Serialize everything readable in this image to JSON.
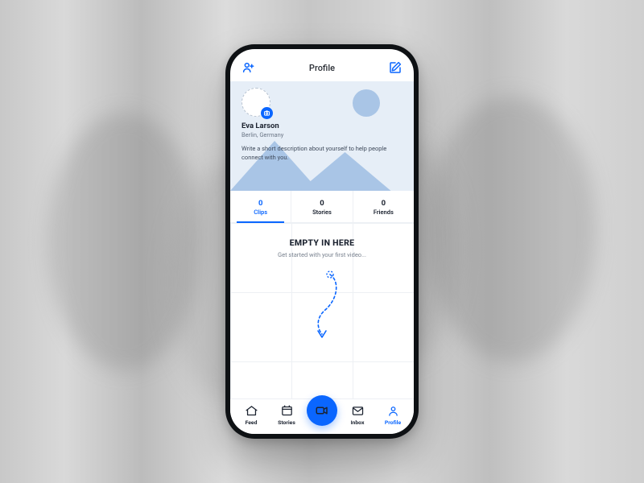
{
  "header": {
    "title": "Profile"
  },
  "profile": {
    "name": "Eva Larson",
    "location": "Berlin, Germany",
    "bio": "Write a short description about yourself to help people connect with you."
  },
  "stats": {
    "clips": {
      "count": "0",
      "label": "Clips"
    },
    "stories": {
      "count": "0",
      "label": "Stories"
    },
    "friends": {
      "count": "0",
      "label": "Friends"
    }
  },
  "empty": {
    "title": "EMPTY IN HERE",
    "subtitle": "Get started with your first video..."
  },
  "nav": {
    "feed": "Feed",
    "stories": "Stories",
    "inbox": "Inbox",
    "profile": "Profile"
  },
  "colors": {
    "accent": "#0a66ff"
  }
}
